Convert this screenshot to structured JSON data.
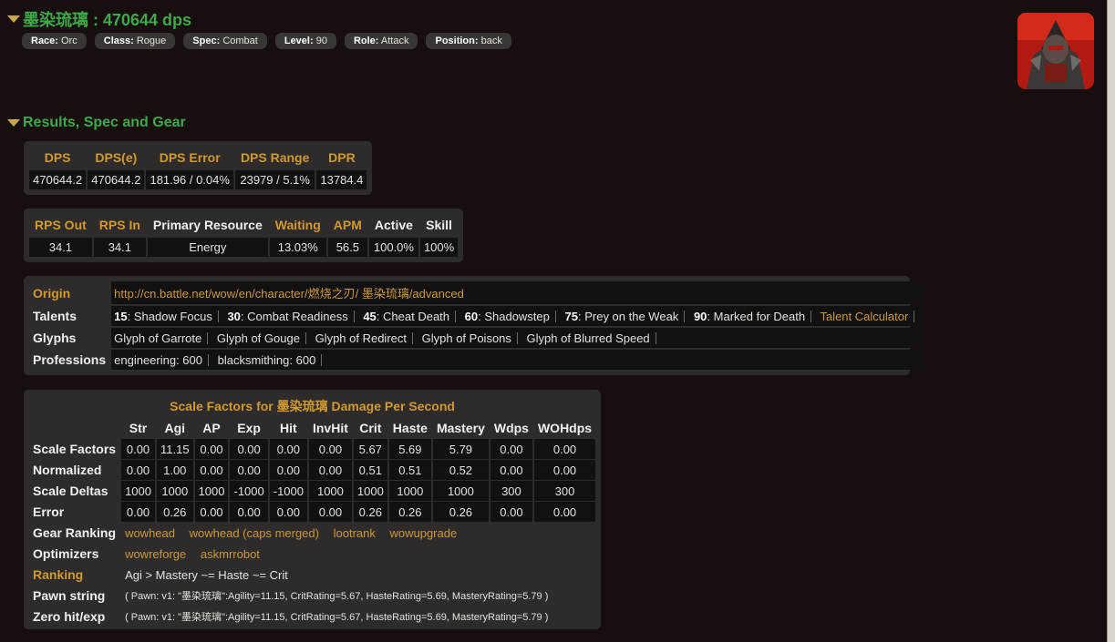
{
  "player": {
    "title": "墨染琉璃 : 470644 dps",
    "badges": [
      {
        "label": "Race:",
        "value": "Orc"
      },
      {
        "label": "Class:",
        "value": "Rogue"
      },
      {
        "label": "Spec:",
        "value": "Combat"
      },
      {
        "label": "Level:",
        "value": "90"
      },
      {
        "label": "Role:",
        "value": "Attack"
      },
      {
        "label": "Position:",
        "value": "back"
      }
    ]
  },
  "results": {
    "title": "Results, Spec and Gear",
    "dps_table": {
      "headers": [
        "DPS",
        "DPS(e)",
        "DPS Error",
        "DPS Range",
        "DPR"
      ],
      "values": [
        "470644.2",
        "470644.2",
        "181.96 / 0.04%",
        "23979 / 5.1%",
        "13784.4"
      ]
    },
    "resource_table": {
      "headers": [
        "RPS Out",
        "RPS In",
        "Primary Resource",
        "Waiting",
        "APM",
        "Active",
        "Skill"
      ],
      "values": [
        "34.1",
        "34.1",
        "Energy",
        "13.03%",
        "56.5",
        "100.0%",
        "100%"
      ]
    },
    "info": {
      "origin_label": "Origin",
      "origin_url": "http://cn.battle.net/wow/en/character/燃烧之刃/ 墨染琉璃/advanced",
      "talents_label": "Talents",
      "talents": [
        {
          "level": "15",
          "name": ": Shadow Focus"
        },
        {
          "level": "30",
          "name": ": Combat Readiness"
        },
        {
          "level": "45",
          "name": ": Cheat Death"
        },
        {
          "level": "60",
          "name": ": Shadowstep"
        },
        {
          "level": "75",
          "name": ": Prey on the Weak"
        },
        {
          "level": "90",
          "name": ": Marked for Death"
        }
      ],
      "talent_calculator": "Talent Calculator",
      "glyphs_label": "Glyphs",
      "glyphs": [
        "Glyph of Garrote",
        "Glyph of Gouge",
        "Glyph of Redirect",
        "Glyph of Poisons",
        "Glyph of Blurred Speed"
      ],
      "professions_label": "Professions",
      "professions": [
        "engineering: 600",
        "blacksmithing: 600"
      ]
    },
    "scale_factors": {
      "title": "Scale Factors for 墨染琉璃 Damage Per Second",
      "columns": [
        "Str",
        "Agi",
        "AP",
        "Exp",
        "Hit",
        "InvHit",
        "Crit",
        "Haste",
        "Mastery",
        "Wdps",
        "WOHdps"
      ],
      "rows": [
        {
          "label": "Scale Factors",
          "values": [
            "0.00",
            "11.15",
            "0.00",
            "0.00",
            "0.00",
            "0.00",
            "5.67",
            "5.69",
            "5.79",
            "0.00",
            "0.00"
          ]
        },
        {
          "label": "Normalized",
          "values": [
            "0.00",
            "1.00",
            "0.00",
            "0.00",
            "0.00",
            "0.00",
            "0.51",
            "0.51",
            "0.52",
            "0.00",
            "0.00"
          ]
        },
        {
          "label": "Scale Deltas",
          "values": [
            "1000",
            "1000",
            "1000",
            "-1000",
            "-1000",
            "1000",
            "1000",
            "1000",
            "1000",
            "300",
            "300"
          ]
        },
        {
          "label": "Error",
          "values": [
            "0.00",
            "0.26",
            "0.00",
            "0.00",
            "0.00",
            "0.00",
            "0.26",
            "0.26",
            "0.26",
            "0.00",
            "0.00"
          ]
        }
      ],
      "gear_ranking_label": "Gear Ranking",
      "gear_ranking_links": [
        "wowhead",
        "wowhead (caps merged)",
        "lootrank",
        "wowupgrade"
      ],
      "optimizers_label": "Optimizers",
      "optimizers_links": [
        "wowreforge",
        "askmrrobot"
      ],
      "ranking_label": "Ranking",
      "ranking_value": "Agi > Mastery ~= Haste ~= Crit",
      "pawn_label": "Pawn string",
      "pawn_value": "( Pawn: v1: \"墨染琉璃\":Agility=11.15, CritRating=5.67, HasteRating=5.69, MasteryRating=5.79 )",
      "zero_label": "Zero hit/exp",
      "zero_value": "( Pawn: v1: \"墨染琉璃\":Agility=11.15, CritRating=5.67, HasteRating=5.69, MasteryRating=5.79 )"
    }
  },
  "colors": {
    "background": "#160f0e",
    "panel": "#2e2b2a",
    "title_green": "#3fa84a",
    "header_gold": "#d09a2c",
    "link_gold": "#c99a3c"
  }
}
